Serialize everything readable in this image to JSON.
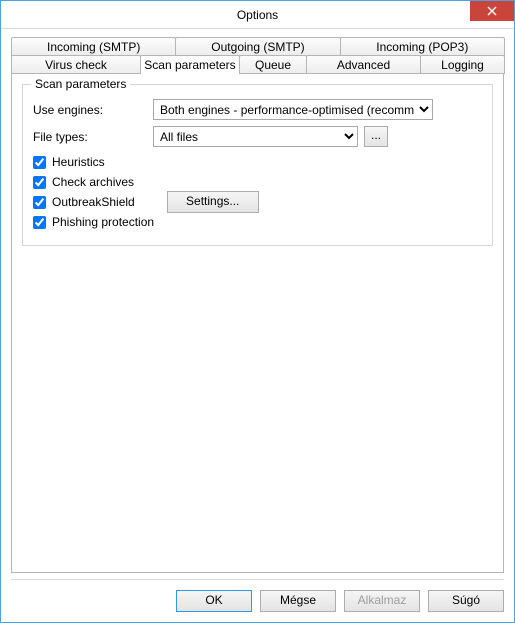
{
  "window": {
    "title": "Options"
  },
  "tabs": {
    "top": [
      "Incoming (SMTP)",
      "Outgoing (SMTP)",
      "Incoming (POP3)"
    ],
    "bottom": [
      "Virus check",
      "Scan parameters",
      "Queue",
      "Advanced",
      "Logging"
    ],
    "active": "Scan parameters"
  },
  "group": {
    "legend": "Scan parameters",
    "use_engines_label": "Use engines:",
    "use_engines_value": "Both engines - performance-optimised (recommended)",
    "file_types_label": "File types:",
    "file_types_value": "All files",
    "ellipsis": "...",
    "heuristics": {
      "label": "Heuristics",
      "checked": true
    },
    "check_archives": {
      "label": "Check archives",
      "checked": true
    },
    "outbreak_shield": {
      "label": "OutbreakShield",
      "checked": true
    },
    "phishing": {
      "label": "Phishing protection",
      "checked": true
    },
    "settings_btn": "Settings..."
  },
  "buttons": {
    "ok": "OK",
    "cancel": "Mégse",
    "apply": "Alkalmaz",
    "help": "Súgó"
  }
}
